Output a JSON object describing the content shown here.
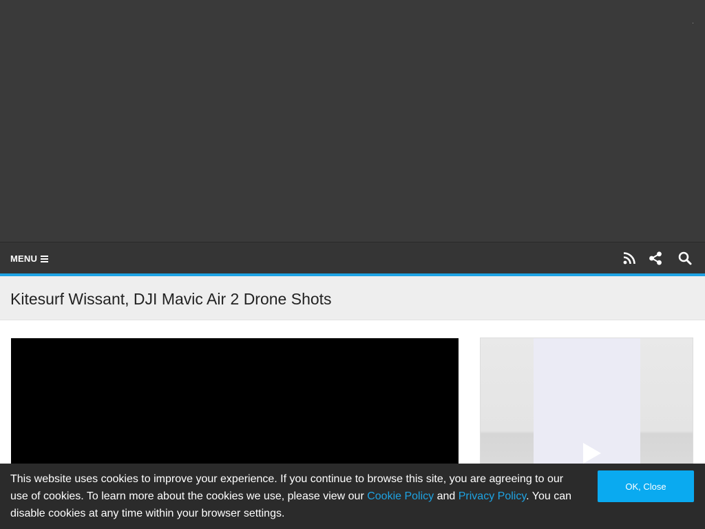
{
  "nav": {
    "menu_label": "MENU",
    "icons": [
      "rss-icon",
      "share-icon",
      "search-icon"
    ]
  },
  "article": {
    "title": "Kitesurf Wissant, DJI Mavic Air 2 Drone Shots"
  },
  "cookie": {
    "text_before": "This website uses cookies to improve your experience. If you continue to browse this site, you are agreeing to our use of cookies. To learn more about the cookies we use, please view our ",
    "cookie_policy_link": "Cookie Policy",
    "text_and": " and ",
    "privacy_policy_link": "Privacy Policy",
    "text_after": ". You can disable cookies at any time within your browser settings.",
    "button_label": "OK, Close"
  },
  "colors": {
    "accent": "#1ea3e3",
    "button": "#0aaaf0",
    "navbar": "#353535",
    "hero": "#3a3a3a",
    "cookie_bar": "#2b2b2b"
  }
}
